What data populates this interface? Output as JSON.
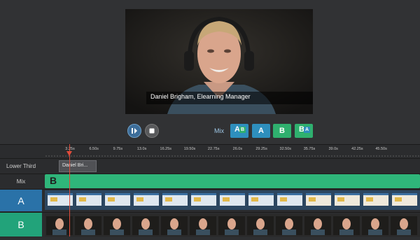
{
  "preview": {
    "caption": "Daniel Brigham, Elearning Manager"
  },
  "controls": {
    "step_icon": "step-frame-icon",
    "stop_icon": "stop-icon"
  },
  "mix": {
    "label": "Mix",
    "buttons": [
      {
        "label": "A",
        "sub": "B",
        "name": "mix-a-over-b-button",
        "color": "#2e8fbd"
      },
      {
        "label": "A",
        "sub": "",
        "name": "mix-a-button",
        "color": "#2e8fbd"
      },
      {
        "label": "B",
        "sub": "",
        "name": "mix-b-button",
        "color": "#2fb06e"
      },
      {
        "label": "B",
        "sub": "A",
        "name": "mix-b-over-a-button",
        "color": "#2fb06e"
      }
    ]
  },
  "timeline": {
    "ticks": [
      "3.25s",
      "6.50s",
      "9.75s",
      "13.0s",
      "16.25s",
      "19.50s",
      "22.75s",
      "26.0s",
      "29.25s",
      "32.50s",
      "35.75s",
      "39.0s",
      "42.25s",
      "45.50s"
    ],
    "tracks": {
      "lower_third": "Lower Third",
      "mix": "Mix",
      "a": "A",
      "b": "B"
    },
    "lower_third_clip": "Daniel Bri...",
    "mix_clip": "B",
    "colors": {
      "a_track": "#2a72a8",
      "b_track": "#22a37a",
      "mix_track": "#2fb67a",
      "playhead": "#e04b3a"
    }
  }
}
